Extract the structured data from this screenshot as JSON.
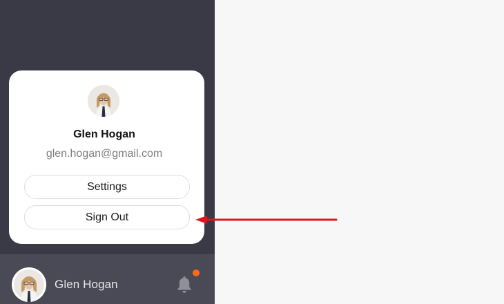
{
  "user": {
    "name": "Glen Hogan",
    "email": "glen.hogan@gmail.com"
  },
  "profile_menu": {
    "settings_label": "Settings",
    "sign_out_label": "Sign Out"
  },
  "footer": {
    "user_name": "Glen Hogan",
    "notification_icon": "bell-icon",
    "has_unread_notification": true
  },
  "colors": {
    "sidebar_bg": "#3a3a46",
    "footer_bg": "#494a55",
    "notification_dot": "#ff6a13",
    "annotation_arrow": "#e0141a"
  }
}
